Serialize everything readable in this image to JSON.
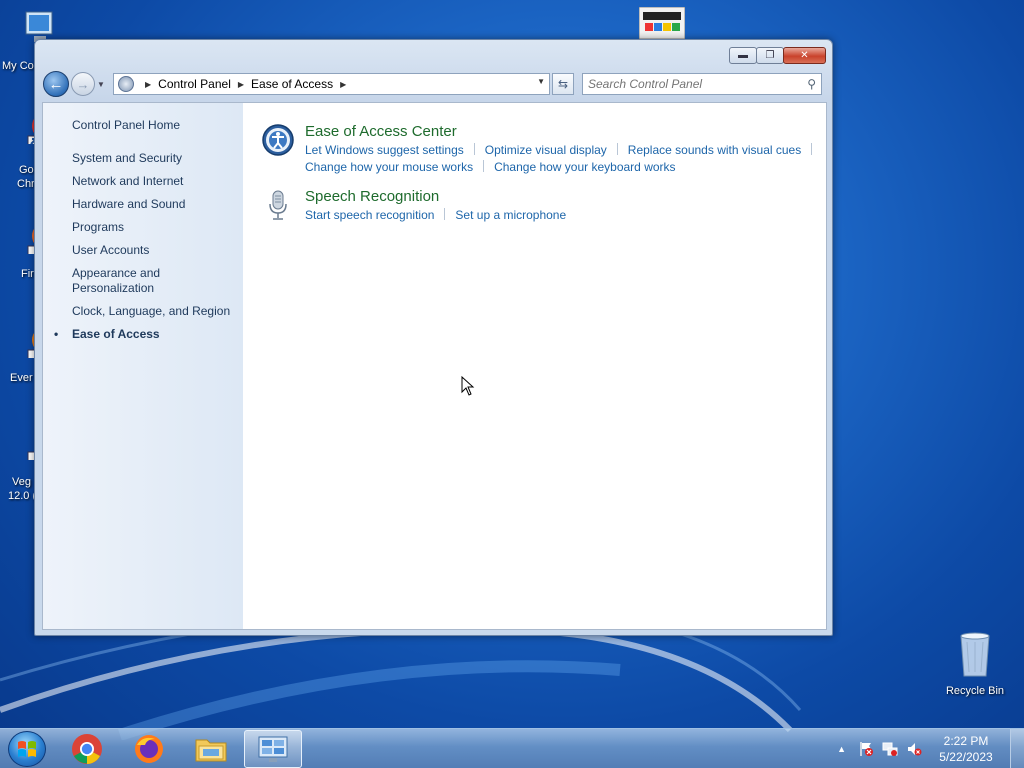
{
  "desktop": {
    "icons_left": [
      {
        "label_lines": [
          "My Co"
        ]
      },
      {
        "label_lines": [
          "Go",
          "Chr"
        ]
      },
      {
        "label_lines": [
          "Fir"
        ]
      },
      {
        "label_lines": [
          "Ever"
        ]
      },
      {
        "label_lines": [
          "Veg",
          "12.0 ("
        ]
      }
    ],
    "recycle_bin": "Recycle Bin"
  },
  "window": {
    "address": {
      "crumbs": [
        "Control Panel",
        "Ease of Access"
      ]
    },
    "search": {
      "placeholder": "Search Control Panel"
    },
    "left_pane": {
      "home": "Control Panel Home",
      "items": [
        "System and Security",
        "Network and Internet",
        "Hardware and Sound",
        "Programs",
        "User Accounts",
        "Appearance and\nPersonalization",
        "Clock, Language, and Region",
        "Ease of Access"
      ],
      "current_index": 7
    },
    "categories": [
      {
        "title": "Ease of Access Center",
        "icon": "ease-of-access-icon",
        "links_row1": [
          "Let Windows suggest settings",
          "Optimize visual display",
          "Replace sounds with visual cues"
        ],
        "links_row2": [
          "Change how your mouse works",
          "Change how your keyboard works"
        ]
      },
      {
        "title": "Speech Recognition",
        "icon": "microphone-icon",
        "links_row1": [
          "Start speech recognition",
          "Set up a microphone"
        ]
      }
    ]
  },
  "taskbar": {
    "apps": [
      "chrome-icon",
      "firefox-icon",
      "file-explorer-icon",
      "control-panel-icon"
    ],
    "clock": {
      "time": "2:22 PM",
      "date": "5/22/2023"
    }
  },
  "colors": {
    "link": "#1e66aa",
    "category_title": "#1e6b2d",
    "nav_text": "#1e395b"
  }
}
